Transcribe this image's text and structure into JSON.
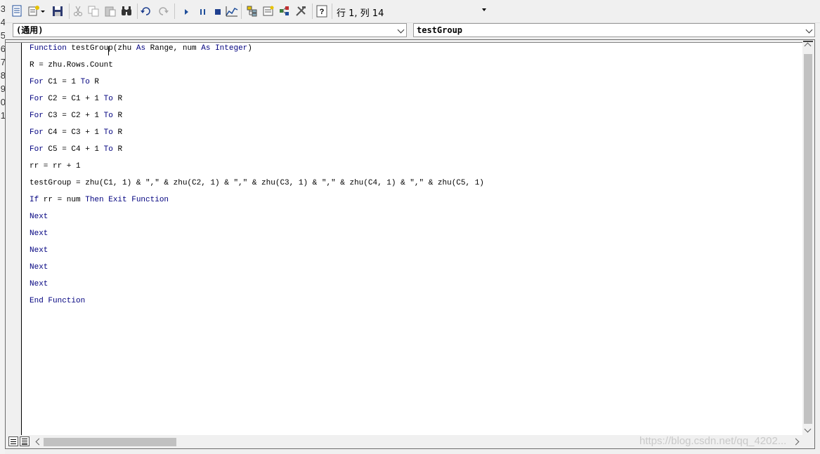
{
  "toolbar": {
    "cursor_position": "行 1, 列 14",
    "icons": [
      "view-excel-icon",
      "insert-module-icon",
      "save-icon",
      "cut-icon",
      "copy-icon",
      "paste-icon",
      "find-icon",
      "undo-icon",
      "redo-icon",
      "run-icon",
      "break-icon",
      "reset-icon",
      "design-mode-icon",
      "project-explorer-icon",
      "properties-window-icon",
      "object-browser-icon",
      "toolbox-icon",
      "help-icon"
    ]
  },
  "object_combo": {
    "value": "(通用)"
  },
  "procedure_combo": {
    "value": "testGroup"
  },
  "row_headers": [
    "3",
    "4",
    "5",
    "6",
    "7",
    "8",
    "9",
    "0",
    "1"
  ],
  "code": {
    "lines": [
      [
        {
          "t": "Function ",
          "k": true
        },
        {
          "t": "testGroup(zhu ",
          "k": false
        },
        {
          "t": "As",
          "k": true
        },
        {
          "t": " Range, num ",
          "k": false
        },
        {
          "t": "As",
          "k": true
        },
        {
          "t": " ",
          "k": false
        },
        {
          "t": "Integer",
          "k": true
        },
        {
          "t": ")",
          "k": false
        }
      ],
      [
        {
          "t": "R = zhu.Rows.Count",
          "k": false
        }
      ],
      [
        {
          "t": "For",
          "k": true
        },
        {
          "t": " C1 = 1 ",
          "k": false
        },
        {
          "t": "To",
          "k": true
        },
        {
          "t": " R",
          "k": false
        }
      ],
      [
        {
          "t": "For",
          "k": true
        },
        {
          "t": " C2 = C1 + 1 ",
          "k": false
        },
        {
          "t": "To",
          "k": true
        },
        {
          "t": " R",
          "k": false
        }
      ],
      [
        {
          "t": "For",
          "k": true
        },
        {
          "t": " C3 = C2 + 1 ",
          "k": false
        },
        {
          "t": "To",
          "k": true
        },
        {
          "t": " R",
          "k": false
        }
      ],
      [
        {
          "t": "For",
          "k": true
        },
        {
          "t": " C4 = C3 + 1 ",
          "k": false
        },
        {
          "t": "To",
          "k": true
        },
        {
          "t": " R",
          "k": false
        }
      ],
      [
        {
          "t": "For",
          "k": true
        },
        {
          "t": " C5 = C4 + 1 ",
          "k": false
        },
        {
          "t": "To",
          "k": true
        },
        {
          "t": " R",
          "k": false
        }
      ],
      [
        {
          "t": "rr = rr + 1",
          "k": false
        }
      ],
      [
        {
          "t": "testGroup = zhu(C1, 1) & \",\" & zhu(C2, 1) & \",\" & zhu(C3, 1) & \",\" & zhu(C4, 1) & \",\" & zhu(C5, 1)",
          "k": false
        }
      ],
      [
        {
          "t": "If",
          "k": true
        },
        {
          "t": " rr = num ",
          "k": false
        },
        {
          "t": "Then Exit Function",
          "k": true
        }
      ],
      [
        {
          "t": "Next",
          "k": true
        }
      ],
      [
        {
          "t": "Next",
          "k": true
        }
      ],
      [
        {
          "t": "Next",
          "k": true
        }
      ],
      [
        {
          "t": "Next",
          "k": true
        }
      ],
      [
        {
          "t": "Next",
          "k": true
        }
      ],
      [
        {
          "t": "End Function",
          "k": true
        }
      ]
    ]
  },
  "watermark": "https://blog.csdn.net/qq_4202..."
}
